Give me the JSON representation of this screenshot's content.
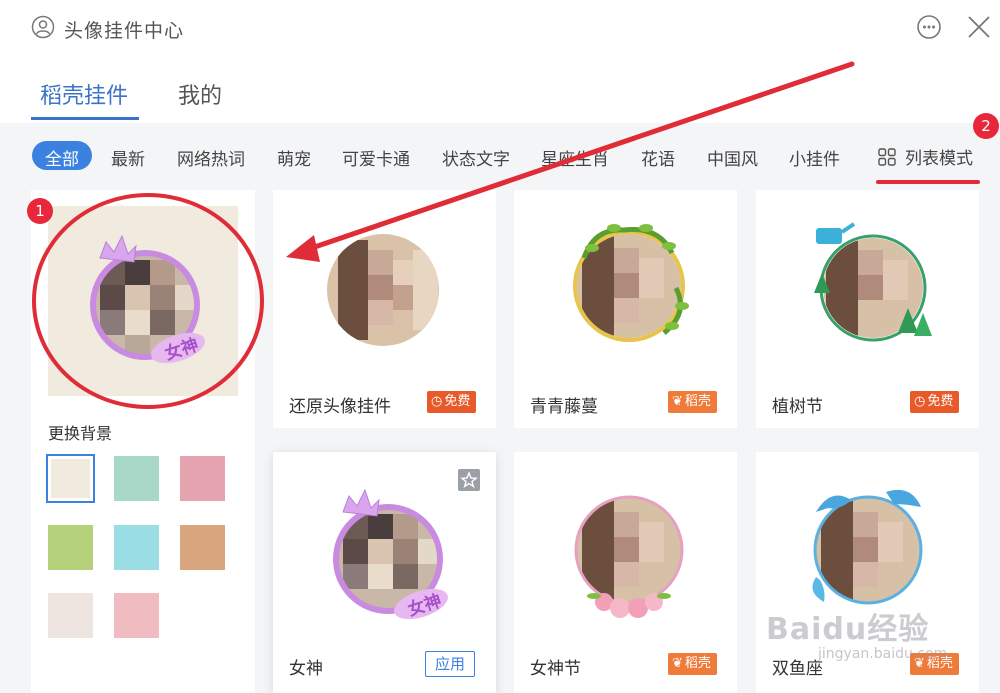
{
  "header": {
    "title": "头像挂件中心",
    "tabs": [
      {
        "label": "稻壳挂件",
        "active": true
      },
      {
        "label": "我的",
        "active": false
      }
    ]
  },
  "categories": [
    "全部",
    "最新",
    "网络热词",
    "萌宠",
    "可爱卡通",
    "状态文字",
    "星座生肖",
    "花语",
    "中国风",
    "小挂件"
  ],
  "active_category": "全部",
  "list_mode_label": "列表模式",
  "annotations": {
    "badge1": "1",
    "badge2": "2"
  },
  "left_panel": {
    "preview_text": "女神",
    "background_label": "更换背景",
    "swatches": [
      "#f0ebde",
      "#a8d8c8",
      "#e6a3b0",
      "#b6d17c",
      "#9bdde5",
      "#d9a57e",
      "#efe5e0",
      "#eebcc1"
    ]
  },
  "cards": [
    {
      "label": "还原头像挂件",
      "tag": "免费",
      "tag_type": "free",
      "frame": "none"
    },
    {
      "label": "青青藤蔓",
      "tag": "稻壳",
      "tag_type": "shell",
      "frame": "vine"
    },
    {
      "label": "植树节",
      "tag": "免费",
      "tag_type": "free",
      "frame": "tree"
    },
    {
      "label": "女神",
      "button": "应用",
      "frame": "goddess"
    },
    {
      "label": "女神节",
      "tag": "稻壳",
      "tag_type": "shell",
      "frame": "flower"
    },
    {
      "label": "双鱼座",
      "tag": "稻壳",
      "tag_type": "shell",
      "frame": "fish"
    }
  ],
  "watermark": {
    "brand": "Baidu经验",
    "url": "jingyan.baidu.com"
  },
  "colors": {
    "accent": "#3b82e0",
    "annotation_red": "#e8283a",
    "tag_orange": "#ef7b3a"
  }
}
